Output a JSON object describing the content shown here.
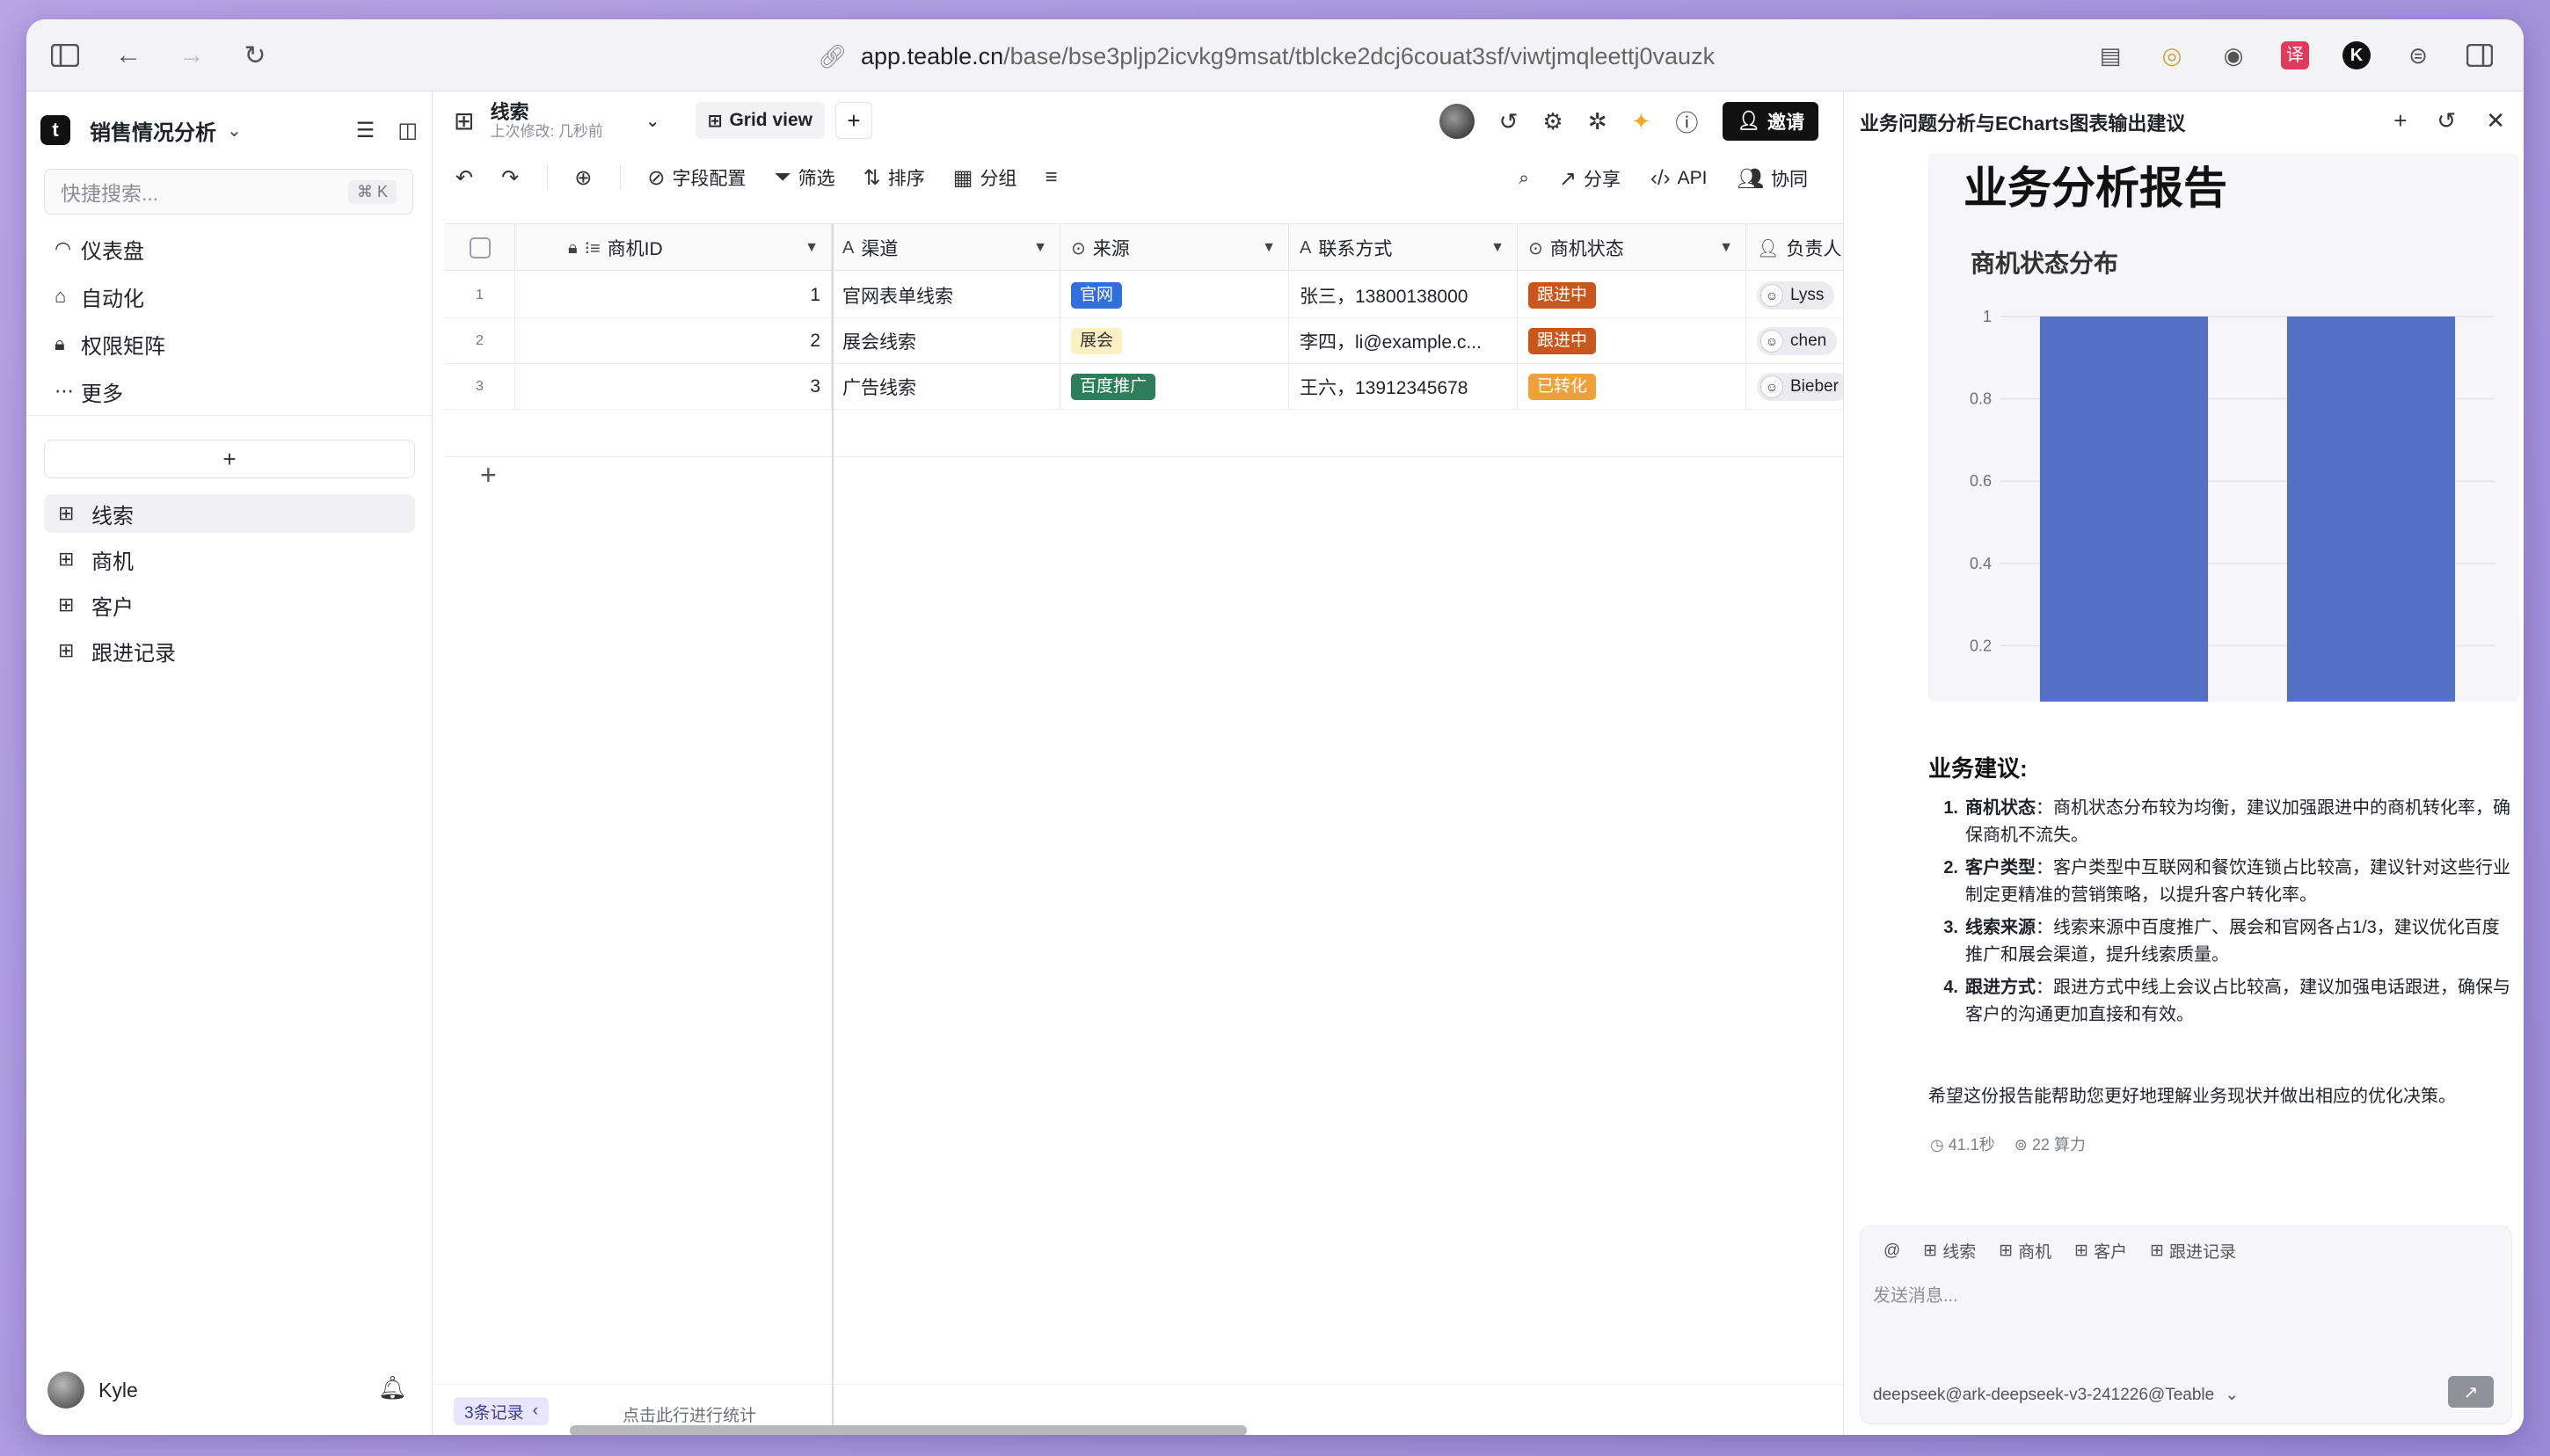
{
  "browser": {
    "url_host": "app.teable.cn",
    "url_path": "/base/bse3pljp2icvkg9msat/tblcke2dcj6couat3sf/viwtjmqleettj0vauzk"
  },
  "sidebar": {
    "base_title": "销售情况分析",
    "search_placeholder": "快捷搜索...",
    "search_shortcut": "⌘ K",
    "nav": [
      {
        "label": "仪表盘",
        "icon": "dashboard-icon"
      },
      {
        "label": "自动化",
        "icon": "robot-icon"
      },
      {
        "label": "权限矩阵",
        "icon": "lock-icon"
      },
      {
        "label": "更多",
        "icon": "more-icon"
      }
    ],
    "add_label": "+",
    "tables": [
      {
        "label": "线索",
        "active": true
      },
      {
        "label": "商机",
        "active": false
      },
      {
        "label": "客户",
        "active": false
      },
      {
        "label": "跟进记录",
        "active": false
      }
    ],
    "user_name": "Kyle"
  },
  "main": {
    "table_title": "线索",
    "last_modified": "上次修改:  几秒前",
    "view_name": "Grid view",
    "invite_label": "邀请",
    "toolbar": {
      "fields": "字段配置",
      "filter": "筛选",
      "sort": "排序",
      "group": "分组",
      "share": "分享",
      "api": "API",
      "collab": "协同"
    },
    "columns": [
      "商机ID",
      "渠道",
      "来源",
      "联系方式",
      "商机状态",
      "负责人"
    ],
    "rows": [
      {
        "idx": "1",
        "id": "1",
        "channel": "官网表单线索",
        "source": "官网",
        "contact": "张三，13800138000",
        "status": "跟进中",
        "owner": "Lyss"
      },
      {
        "idx": "2",
        "id": "2",
        "channel": "展会线索",
        "source": "展会",
        "contact": "李四，li@example.c...",
        "status": "跟进中",
        "owner": "chen"
      },
      {
        "idx": "3",
        "id": "3",
        "channel": "广告线索",
        "source": "百度推广",
        "contact": "王六，13912345678",
        "status": "已转化",
        "owner": "Bieber"
      }
    ],
    "footer": {
      "records": "3条记录",
      "stats_hint": "点击此行进行统计"
    }
  },
  "colors": {
    "source_tags": {
      "官网": {
        "bg": "#2f6fde",
        "fg": "#ffffff"
      },
      "展会": {
        "bg": "#fdf1c4",
        "fg": "#333333"
      },
      "百度推广": {
        "bg": "#2e7d5b",
        "fg": "#ffffff"
      }
    },
    "status_tags": {
      "跟进中": {
        "bg": "#c9561b",
        "fg": "#ffffff"
      },
      "已转化": {
        "bg": "#f0a13a",
        "fg": "#ffffff"
      }
    },
    "bar": "#5470c6"
  },
  "panel": {
    "title": "业务问题分析与ECharts图表输出建议",
    "report_title": "业务分析报告",
    "chart_title": "商机状态分布",
    "suggestions_title": "业务建议:",
    "suggestions": [
      {
        "n": "1.",
        "head": "商机状态",
        "text": "：商机状态分布较为均衡，建议加强跟进中的商机转化率，确保商机不流失。"
      },
      {
        "n": "2.",
        "head": "客户类型",
        "text": "：客户类型中互联网和餐饮连锁占比较高，建议针对这些行业制定更精准的营销策略，以提升客户转化率。"
      },
      {
        "n": "3.",
        "head": "线索来源",
        "text": "：线索来源中百度推广、展会和官网各占1/3，建议优化百度推广和展会渠道，提升线索质量。"
      },
      {
        "n": "4.",
        "head": "跟进方式",
        "text": "：跟进方式中线上会议占比较高，建议加强电话跟进，确保与客户的沟通更加直接和有效。"
      }
    ],
    "closing": "希望这份报告能帮助您更好地理解业务现状并做出相应的优化决策。",
    "elapsed": "41.1秒",
    "compute": "22 算力",
    "composer": {
      "chips": [
        "@",
        "线索",
        "商机",
        "客户",
        "跟进记录"
      ],
      "placeholder": "发送消息...",
      "model": "deepseek@ark-deepseek-v3-241226@Teable"
    }
  },
  "chart_data": {
    "type": "bar",
    "title": "商机状态分布",
    "categories": [
      "",
      ""
    ],
    "values": [
      1,
      1
    ],
    "ylim": [
      0,
      1
    ],
    "yticks": [
      "0.2",
      "0.4",
      "0.6",
      "0.8",
      "1"
    ],
    "grid": true
  }
}
